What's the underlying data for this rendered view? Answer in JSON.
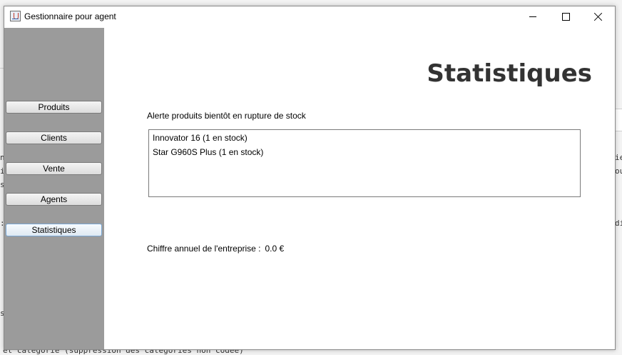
{
  "background": {
    "bottom_text": "et catégorie (suppression des catégories non codée)",
    "right_fragments": [
      "ie",
      "ou",
      "di"
    ]
  },
  "window": {
    "title": "Gestionnaire pour agent",
    "minimize_label": "—",
    "maximize_label": "□",
    "close_label": "✕"
  },
  "sidebar": {
    "items": [
      {
        "label": "Produits"
      },
      {
        "label": "Clients"
      },
      {
        "label": "Vente"
      },
      {
        "label": "Agents"
      },
      {
        "label": "Statistiques"
      }
    ],
    "active": "Statistiques"
  },
  "main": {
    "title": "Statistiques",
    "alert_label": "Alerte produits bientôt en rupture de stock",
    "low_stock": [
      "Innovator 16 (1 en stock)",
      "Star G960S Plus (1 en stock)"
    ],
    "revenue_label": "Chiffre annuel de l'entreprise :",
    "revenue_value": "0.0 €"
  },
  "colors": {
    "sidebar_bg": "#9b9b9b",
    "title_color": "#333333",
    "active_border": "#7aa7d3"
  }
}
